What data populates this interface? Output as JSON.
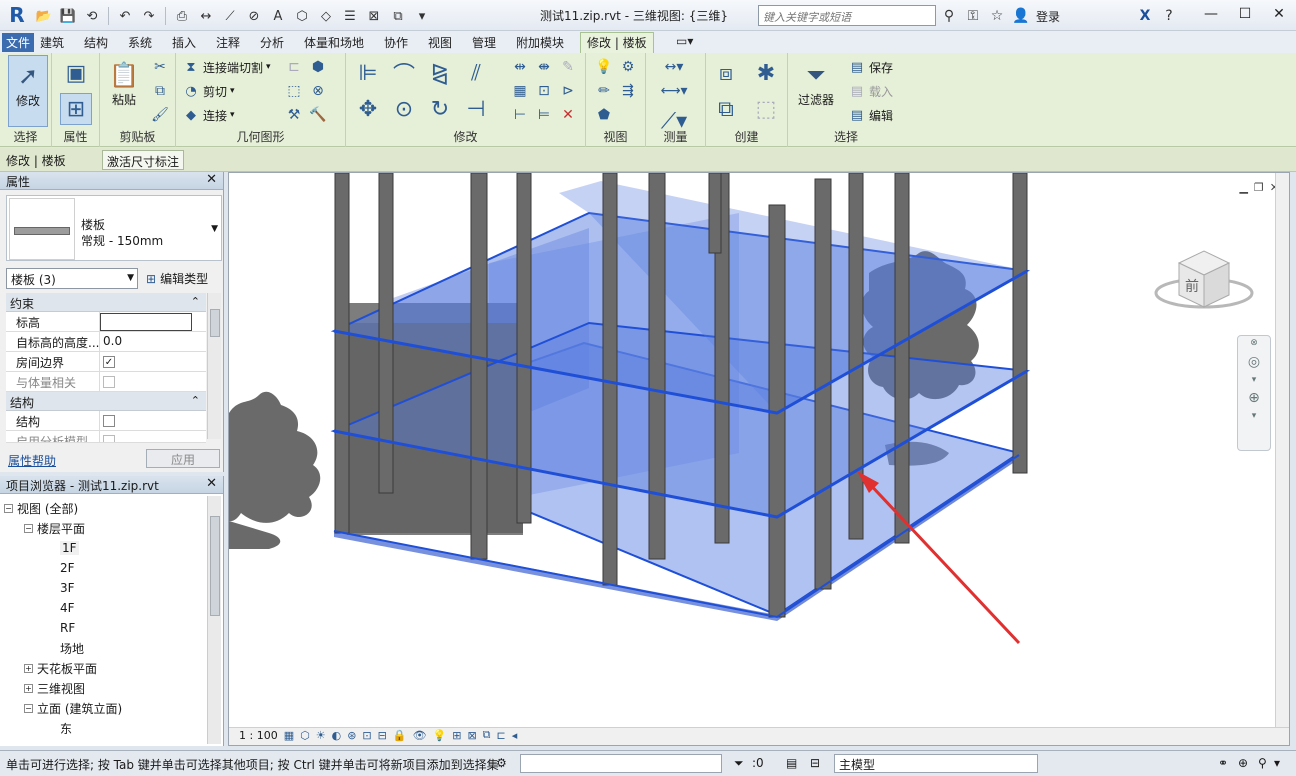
{
  "titlebar": {
    "app_logo": "R",
    "title": "测试11.zip.rvt - 三维视图: {三维}",
    "search_placeholder": "键入关键字或短语",
    "login": "登录"
  },
  "tabs": [
    {
      "label": "文件"
    },
    {
      "label": "建筑"
    },
    {
      "label": "结构"
    },
    {
      "label": "系统"
    },
    {
      "label": "插入"
    },
    {
      "label": "注释"
    },
    {
      "label": "分析"
    },
    {
      "label": "体量和场地"
    },
    {
      "label": "协作"
    },
    {
      "label": "视图"
    },
    {
      "label": "管理"
    },
    {
      "label": "附加模块"
    },
    {
      "label": "修改 | 楼板"
    }
  ],
  "ribbon": {
    "select_group": "选择",
    "modify_btn": "修改",
    "props_group": "属性",
    "clipboard_group": "剪贴板",
    "paste_btn": "粘贴",
    "geometry_group": "几何图形",
    "join_cut": "连接端切割",
    "cut": "剪切",
    "join": "连接",
    "modify_group": "修改",
    "view_group": "视图",
    "measure_group": "测量",
    "create_group": "创建",
    "selection_group": "选择",
    "filter_btn": "过滤器",
    "save": "保存",
    "load": "载入",
    "edit": "编辑"
  },
  "context": {
    "label": "修改 | 楼板",
    "button": "激活尺寸标注"
  },
  "properties": {
    "header": "属性",
    "family": "楼板",
    "type": "常规 - 150mm",
    "instance_filter": "楼板 (3)",
    "edit_type": "编辑类型",
    "categories": [
      {
        "name": "约束",
        "rows": [
          {
            "key": "标高",
            "value": "",
            "kind": "edit"
          },
          {
            "key": "自标高的高度...",
            "value": "0.0",
            "kind": "text"
          },
          {
            "key": "房间边界",
            "value": "✓",
            "kind": "check"
          },
          {
            "key": "与体量相关",
            "value": "",
            "kind": "check-dim"
          }
        ]
      },
      {
        "name": "结构",
        "rows": [
          {
            "key": "结构",
            "value": "",
            "kind": "check"
          },
          {
            "key": "启用分析模型",
            "value": "",
            "kind": "check-dim"
          }
        ]
      }
    ],
    "help": "属性帮助",
    "apply": "应用"
  },
  "browser": {
    "header": "项目浏览器 - 测试11.zip.rvt",
    "nodes": [
      {
        "label": "视图 (全部)",
        "toggle": "−",
        "indent": 0,
        "selected": false
      },
      {
        "label": "楼层平面",
        "toggle": "−",
        "indent": 1,
        "selected": false
      },
      {
        "label": "1F",
        "toggle": "",
        "indent": 2,
        "selected": true
      },
      {
        "label": "2F",
        "toggle": "",
        "indent": 2,
        "selected": false
      },
      {
        "label": "3F",
        "toggle": "",
        "indent": 2,
        "selected": false
      },
      {
        "label": "4F",
        "toggle": "",
        "indent": 2,
        "selected": false
      },
      {
        "label": "RF",
        "toggle": "",
        "indent": 2,
        "selected": false
      },
      {
        "label": "场地",
        "toggle": "",
        "indent": 2,
        "selected": false
      },
      {
        "label": "天花板平面",
        "toggle": "+",
        "indent": 1,
        "selected": false
      },
      {
        "label": "三维视图",
        "toggle": "+",
        "indent": 1,
        "selected": false
      },
      {
        "label": "立面 (建筑立面)",
        "toggle": "−",
        "indent": 1,
        "selected": false
      },
      {
        "label": "东",
        "toggle": "",
        "indent": 2,
        "selected": false
      }
    ]
  },
  "viewport": {
    "viewcube_face": "前",
    "scale": "1 : 100"
  },
  "statusbar": {
    "hint": "单击可进行选择; 按 Tab 键并单击可选择其他项目; 按 Ctrl 键并单击可将新项目添加到选择集",
    "count": ":0",
    "model": "主模型"
  },
  "colors": {
    "ribbon_bg": "#e6f0d8",
    "slab_fill": "#5a7fe0",
    "slab_edge": "#1f4fd6",
    "column": "#5f5f5f",
    "arrow": "#e03030"
  }
}
